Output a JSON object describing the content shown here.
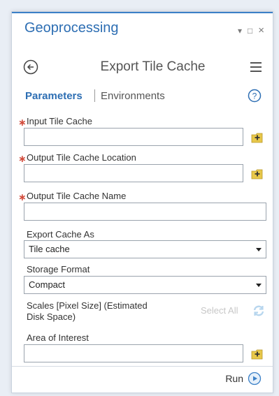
{
  "window": {
    "title": "Geoprocessing",
    "controls": {
      "pin": "▾",
      "maximize": "□",
      "close": "×"
    }
  },
  "tool": {
    "title": "Export Tile Cache",
    "back_icon": "back-circle-icon",
    "menu_icon": "hamburger-menu-icon"
  },
  "tabs": {
    "parameters": "Parameters",
    "environments": "Environments",
    "help_icon": "help-circle-icon"
  },
  "fields": {
    "input_tile_cache": {
      "label": "Input Tile Cache",
      "required_mark": "∗",
      "value": ""
    },
    "output_location": {
      "label": "Output Tile Cache Location",
      "required_mark": "∗",
      "value": ""
    },
    "output_name": {
      "label": "Output Tile Cache Name",
      "required_mark": "∗",
      "value": ""
    },
    "export_cache_as": {
      "label": "Export Cache As",
      "value": "Tile cache"
    },
    "storage_format": {
      "label": "Storage Format",
      "value": "Compact"
    },
    "scales": {
      "label_line1": "Scales [Pixel Size] (Estimated",
      "label_line2": "Disk Space)",
      "select_all": "Select All"
    },
    "area_of_interest": {
      "label": "Area of Interest",
      "value": ""
    }
  },
  "footer": {
    "run_label": "Run",
    "run_icon": "play-circle-icon"
  },
  "colors": {
    "accent": "#2d6eb3",
    "required": "#d24b3b",
    "browse_icon_fill": "#e8c84a"
  }
}
